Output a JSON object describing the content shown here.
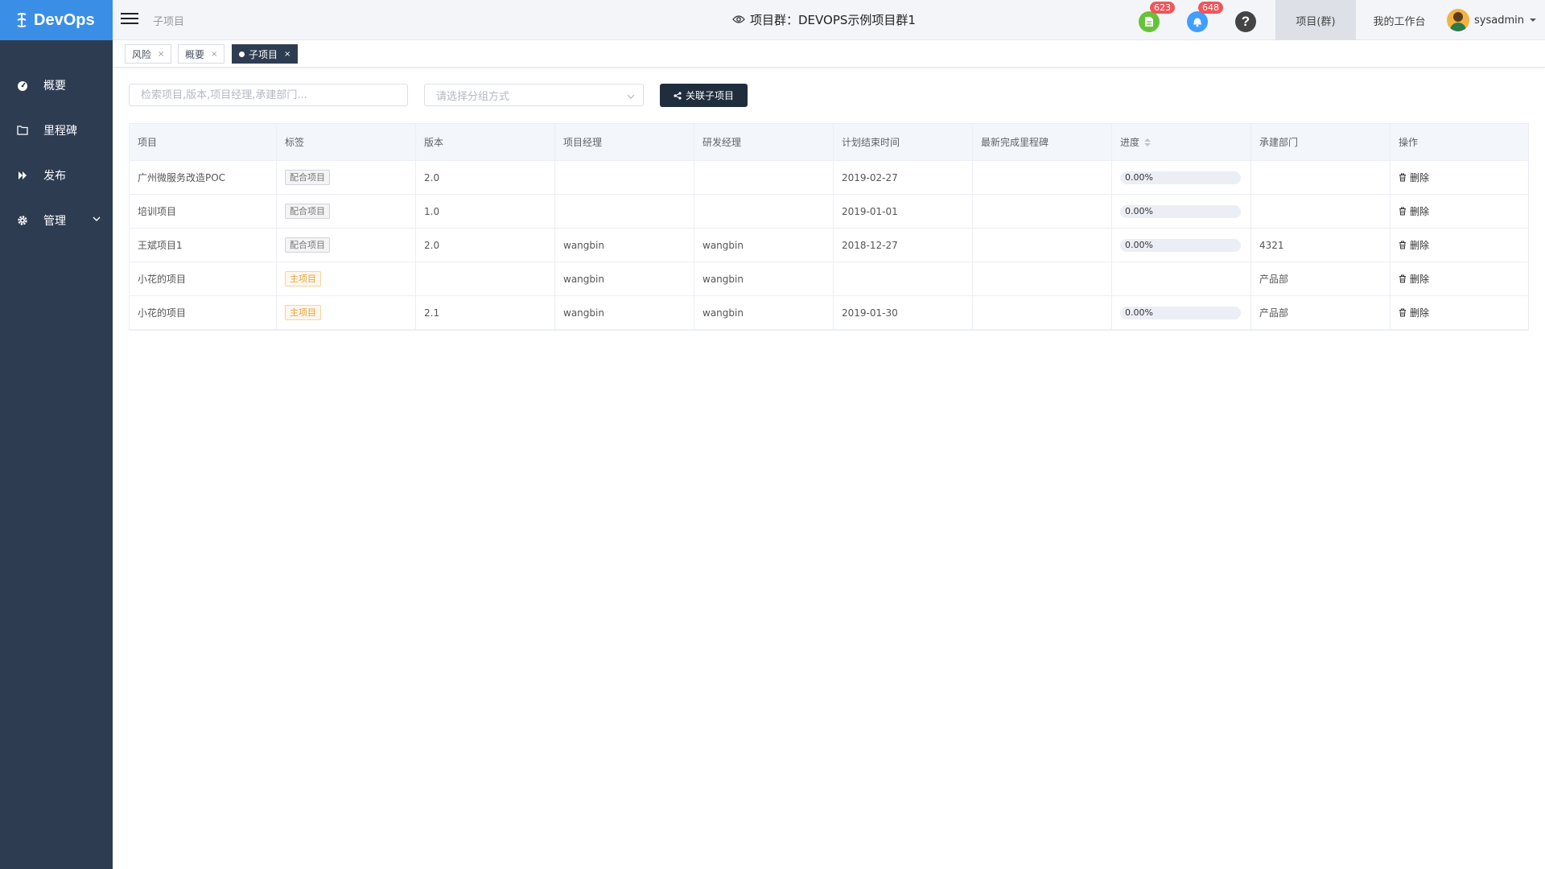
{
  "app": {
    "name": "DevOps"
  },
  "sidebar": {
    "items": [
      {
        "label": "概要",
        "icon": "dashboard-icon"
      },
      {
        "label": "里程碑",
        "icon": "folder-icon"
      },
      {
        "label": "发布",
        "icon": "forward-icon"
      },
      {
        "label": "管理",
        "icon": "gear-icon"
      }
    ]
  },
  "header": {
    "breadcrumb": "子项目",
    "title": "项目群：DEVOPS示例项目群1",
    "badges": {
      "tasks": "623",
      "notifications": "648"
    },
    "tabs": [
      {
        "label": "项目(群)",
        "active": true
      },
      {
        "label": "我的工作台",
        "active": false
      }
    ],
    "user": "sysadmin"
  },
  "tabbar": {
    "tabs": [
      {
        "label": "风险",
        "active": false
      },
      {
        "label": "概要",
        "active": false
      },
      {
        "label": "子项目",
        "active": true
      }
    ]
  },
  "toolbar": {
    "search_placeholder": "检索项目,版本,项目经理,承建部门...",
    "group_placeholder": "请选择分组方式",
    "link_button": "关联子项目"
  },
  "table": {
    "columns": [
      "项目",
      "标签",
      "版本",
      "项目经理",
      "研发经理",
      "计划结束时间",
      "最新完成里程碑",
      "进度",
      "承建部门",
      "操作"
    ],
    "rows": [
      {
        "name": "广州微服务改造POC",
        "tag": "配合项目",
        "tag_type": "secondary",
        "version": "2.0",
        "pm": "",
        "dm": "",
        "end": "2019-02-27",
        "milestone": "",
        "progress": "0.00%",
        "dept": "",
        "action": "删除"
      },
      {
        "name": "培训项目",
        "tag": "配合项目",
        "tag_type": "secondary",
        "version": "1.0",
        "pm": "",
        "dm": "",
        "end": "2019-01-01",
        "milestone": "",
        "progress": "0.00%",
        "dept": "",
        "action": "删除"
      },
      {
        "name": "王斌项目1",
        "tag": "配合项目",
        "tag_type": "secondary",
        "version": "2.0",
        "pm": "wangbin",
        "dm": "wangbin",
        "end": "2018-12-27",
        "milestone": "",
        "progress": "0.00%",
        "dept": "4321",
        "action": "删除"
      },
      {
        "name": "小花的项目",
        "tag": "主项目",
        "tag_type": "primary",
        "version": "",
        "pm": "wangbin",
        "dm": "wangbin",
        "end": "",
        "milestone": "",
        "progress": "",
        "dept": "产品部",
        "action": "删除"
      },
      {
        "name": "小花的项目",
        "tag": "主项目",
        "tag_type": "primary",
        "version": "2.1",
        "pm": "wangbin",
        "dm": "wangbin",
        "end": "2019-01-30",
        "milestone": "",
        "progress": "0.00%",
        "dept": "产品部",
        "action": "删除"
      }
    ]
  },
  "colors": {
    "sidebar": "#2e3c52",
    "logo_bg": "#3a8ee6",
    "badge": "#f0555a",
    "primary_tag": "#e6a23c"
  }
}
